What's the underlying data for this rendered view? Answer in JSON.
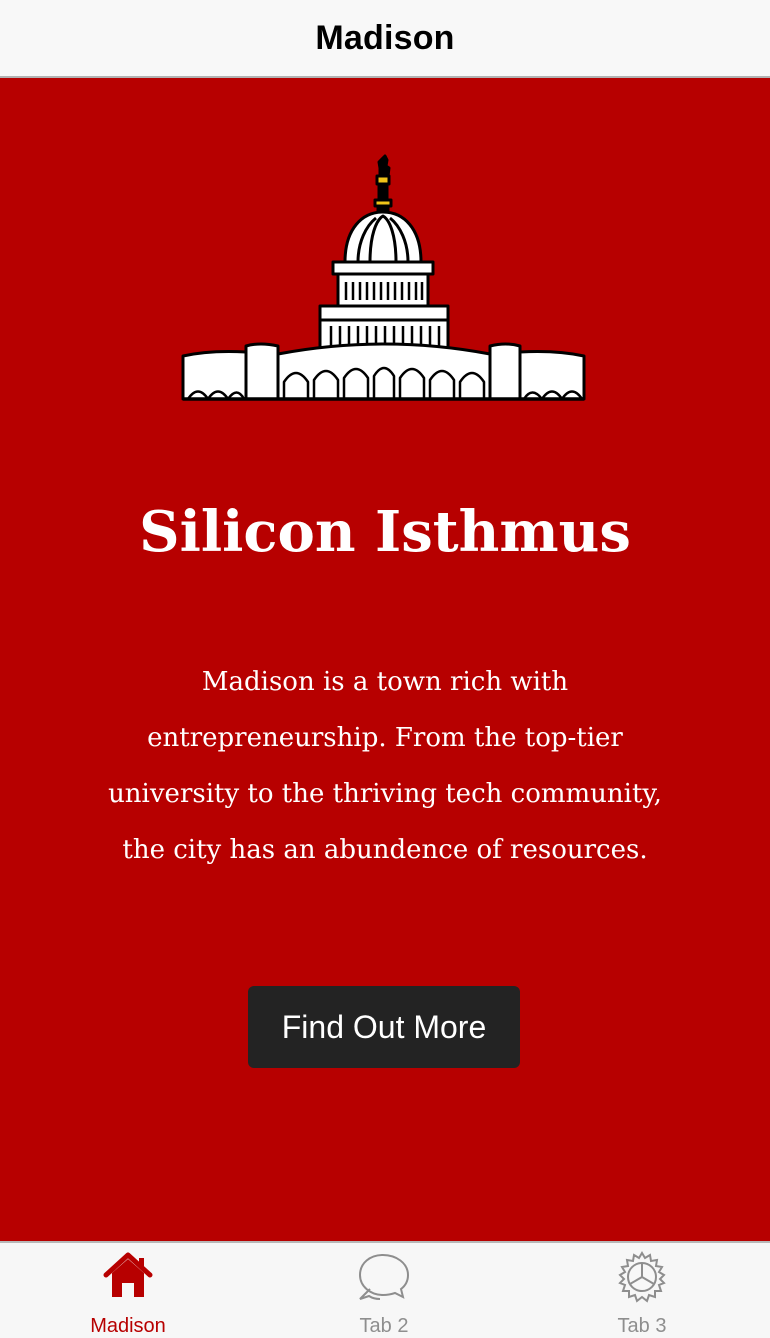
{
  "nav": {
    "title": "Madison"
  },
  "hero": {
    "icon": "capitol-building-icon",
    "headline": "Silicon Isthmus",
    "body": "Madison is a town rich with entrepreneurship. From the top-tier university to the thriving tech community, the city has an abundence of resources.",
    "button_label": "Find Out More"
  },
  "tabs": [
    {
      "label": "Madison",
      "icon": "home-icon",
      "active": true
    },
    {
      "label": "Tab 2",
      "icon": "speech-bubbles-icon",
      "active": false
    },
    {
      "label": "Tab 3",
      "icon": "gear-icon",
      "active": false
    }
  ],
  "colors": {
    "accent": "#b70000",
    "button": "#232323",
    "tab_inactive": "#8e8e8e",
    "capitol_gold": "#f0c419"
  }
}
